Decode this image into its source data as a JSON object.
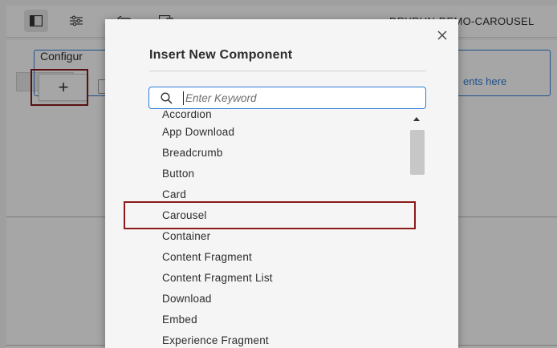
{
  "toolbar": {
    "page_title": "DRYRUN-DEMO-CAROUSEL",
    "icons": [
      "toggle-side-panel-icon",
      "page-properties-icon",
      "undo-icon",
      "emulator-icon"
    ]
  },
  "editor": {
    "panel_label": "Configur",
    "drag_hint": "ents here",
    "add_button_label": "+"
  },
  "dialog": {
    "title": "Insert New Component",
    "close_label": "×",
    "search": {
      "placeholder": "Enter Keyword",
      "value": ""
    },
    "components": [
      "Accordion",
      "App Download",
      "Breadcrumb",
      "Button",
      "Card",
      "Carousel",
      "Container",
      "Content Fragment",
      "Content Fragment List",
      "Download",
      "Embed",
      "Experience Fragment"
    ],
    "highlighted_item": "Carousel"
  },
  "colors": {
    "accent": "#2d7bd6",
    "highlight_frame": "#8b1a1a",
    "dialog_bg": "#f5f5f5"
  }
}
